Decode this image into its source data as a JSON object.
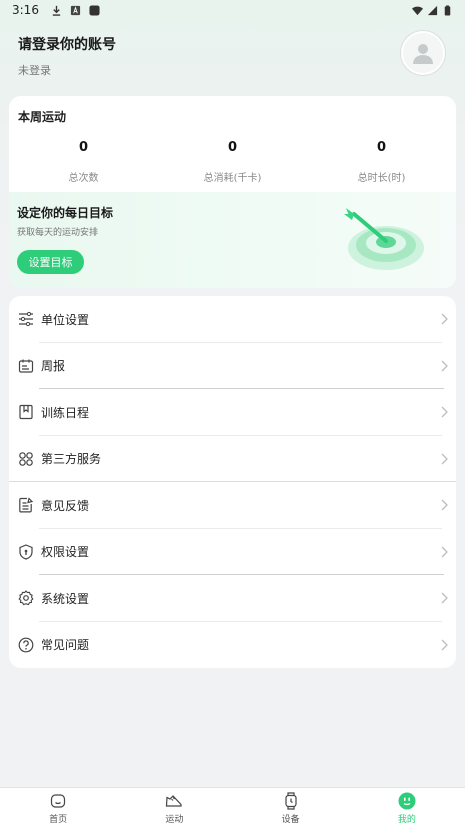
{
  "status_bar": {
    "time": "3:16"
  },
  "header": {
    "title": "请登录你的账号",
    "subtitle": "未登录"
  },
  "week_card": {
    "title": "本周运动",
    "stats": [
      {
        "value": "0",
        "label": "总次数"
      },
      {
        "value": "0",
        "label": "总消耗(千卡)"
      },
      {
        "value": "0",
        "label": "总时长(时)"
      }
    ]
  },
  "goal": {
    "title": "设定你的每日目标",
    "subtitle": "获取每天的运动安排",
    "button_label": "设置目标"
  },
  "menu": {
    "items": [
      {
        "label": "单位设置",
        "icon": "sliders-icon"
      },
      {
        "label": "周报",
        "icon": "calendar-report-icon"
      },
      {
        "label": "训练日程",
        "icon": "bookmark-icon"
      },
      {
        "label": "第三方服务",
        "icon": "grid-services-icon"
      },
      {
        "label": "意见反馈",
        "icon": "feedback-edit-icon"
      },
      {
        "label": "权限设置",
        "icon": "shield-icon"
      },
      {
        "label": "系统设置",
        "icon": "gear-icon"
      },
      {
        "label": "常见问题",
        "icon": "question-icon"
      }
    ]
  },
  "bottom_nav": {
    "items": [
      {
        "label": "首页",
        "icon": "home-icon"
      },
      {
        "label": "运动",
        "icon": "shoe-icon"
      },
      {
        "label": "设备",
        "icon": "watch-icon"
      },
      {
        "label": "我的",
        "icon": "profile-icon"
      }
    ],
    "active_index": 3
  },
  "colors": {
    "accent": "#2ecd7a",
    "background": "#f1f2f4",
    "card": "#ffffff"
  }
}
